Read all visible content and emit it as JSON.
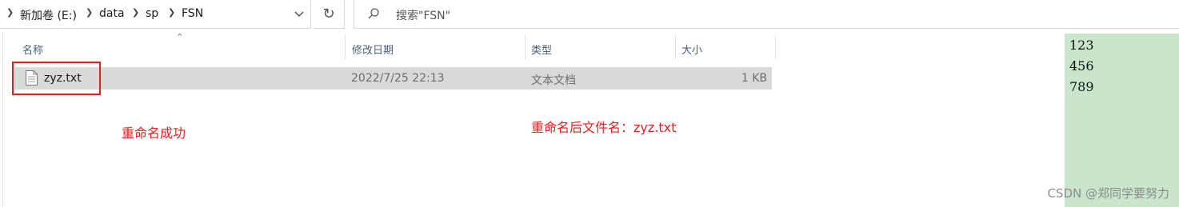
{
  "address_bar": {
    "breadcrumbs": [
      "新加卷 (E:)",
      "data",
      "sp",
      "FSN"
    ]
  },
  "search": {
    "placeholder": "搜索\"FSN\""
  },
  "columns": {
    "name": "名称",
    "date": "修改日期",
    "type": "类型",
    "size": "大小"
  },
  "files": [
    {
      "name": "zyz.txt",
      "modified": "2022/7/25 22:13",
      "type": "文本文档",
      "size": "1 KB"
    }
  ],
  "annotations": {
    "rename_success": "重命名成功",
    "renamed_filename": "重命名后文件名：zyz.txt"
  },
  "text_panel": {
    "lines": [
      "123",
      "456",
      "789"
    ]
  },
  "watermark": "CSDN @郑同学要努力",
  "colors": {
    "annotation_red": "#e61e1e",
    "selected_row": "#d9d9d9",
    "text_panel_bg": "#c9e6cd"
  }
}
